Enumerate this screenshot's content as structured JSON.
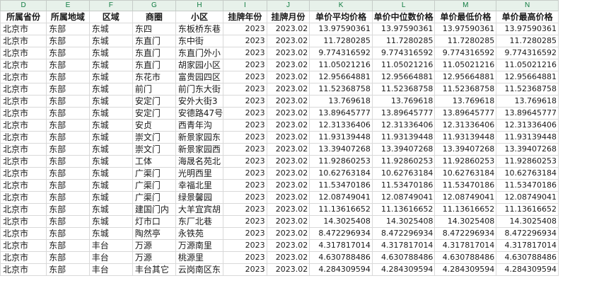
{
  "column_letters": [
    "D",
    "E",
    "F",
    "G",
    "H",
    "I",
    "J",
    "K",
    "L",
    "M",
    "N"
  ],
  "headers": [
    "所属省份",
    "所属地域",
    "区域",
    "商圈",
    "小区",
    "挂牌年份",
    "挂牌月份",
    "单价平均价格",
    "单价中位数价格",
    "单价最低价格",
    "单价最高价格"
  ],
  "rows": [
    [
      "北京市",
      "东部",
      "东城",
      "东四",
      "东板桥东巷",
      "2023",
      "2023.02",
      "13.97590361",
      "13.97590361",
      "13.97590361",
      "13.97590361"
    ],
    [
      "北京市",
      "东部",
      "东城",
      "东直门",
      "东中街",
      "2023",
      "2023.02",
      "11.7280285",
      "11.7280285",
      "11.7280285",
      "11.7280285"
    ],
    [
      "北京市",
      "东部",
      "东城",
      "东直门",
      "东直门外小",
      "2023",
      "2023.02",
      "9.774316592",
      "9.774316592",
      "9.774316592",
      "9.774316592"
    ],
    [
      "北京市",
      "东部",
      "东城",
      "东直门",
      "胡家园小区",
      "2023",
      "2023.02",
      "11.05021216",
      "11.05021216",
      "11.05021216",
      "11.05021216"
    ],
    [
      "北京市",
      "东部",
      "东城",
      "东花市",
      "富贵园四区",
      "2023",
      "2023.02",
      "12.95664881",
      "12.95664881",
      "12.95664881",
      "12.95664881"
    ],
    [
      "北京市",
      "东部",
      "东城",
      "前门",
      "前门东大街",
      "2023",
      "2023.02",
      "11.52368758",
      "11.52368758",
      "11.52368758",
      "11.52368758"
    ],
    [
      "北京市",
      "东部",
      "东城",
      "安定门",
      "安外大街3",
      "2023",
      "2023.02",
      "13.769618",
      "13.769618",
      "13.769618",
      "13.769618"
    ],
    [
      "北京市",
      "东部",
      "东城",
      "安定门",
      "安德路47号",
      "2023",
      "2023.02",
      "13.89645777",
      "13.89645777",
      "13.89645777",
      "13.89645777"
    ],
    [
      "北京市",
      "东部",
      "东城",
      "安贞",
      "西青年沟",
      "2023",
      "2023.02",
      "12.31336406",
      "12.31336406",
      "12.31336406",
      "12.31336406"
    ],
    [
      "北京市",
      "东部",
      "东城",
      "崇文门",
      "新景家园东",
      "2023",
      "2023.02",
      "11.93139448",
      "11.93139448",
      "11.93139448",
      "11.93139448"
    ],
    [
      "北京市",
      "东部",
      "东城",
      "崇文门",
      "新景家园西",
      "2023",
      "2023.02",
      "13.39407268",
      "13.39407268",
      "13.39407268",
      "13.39407268"
    ],
    [
      "北京市",
      "东部",
      "东城",
      "工体",
      "海晟名苑北",
      "2023",
      "2023.02",
      "11.92860253",
      "11.92860253",
      "11.92860253",
      "11.92860253"
    ],
    [
      "北京市",
      "东部",
      "东城",
      "广渠门",
      "光明西里",
      "2023",
      "2023.02",
      "10.62763184",
      "10.62763184",
      "10.62763184",
      "10.62763184"
    ],
    [
      "北京市",
      "东部",
      "东城",
      "广渠门",
      "幸福北里",
      "2023",
      "2023.02",
      "11.53470186",
      "11.53470186",
      "11.53470186",
      "11.53470186"
    ],
    [
      "北京市",
      "东部",
      "东城",
      "广渠门",
      "绿景馨园",
      "2023",
      "2023.02",
      "12.08749041",
      "12.08749041",
      "12.08749041",
      "12.08749041"
    ],
    [
      "北京市",
      "东部",
      "东城",
      "建国门内",
      "大羊宜宾胡",
      "2023",
      "2023.02",
      "11.13616652",
      "11.13616652",
      "11.13616652",
      "11.13616652"
    ],
    [
      "北京市",
      "东部",
      "东城",
      "灯市口",
      "东厂北巷",
      "2023",
      "2023.02",
      "14.3025408",
      "14.3025408",
      "14.3025408",
      "14.3025408"
    ],
    [
      "北京市",
      "东部",
      "东城",
      "陶然亭",
      "永铁苑",
      "2023",
      "2023.02",
      "8.472296934",
      "8.472296934",
      "8.472296934",
      "8.472296934"
    ],
    [
      "北京市",
      "东部",
      "丰台",
      "万源",
      "万源南里",
      "2023",
      "2023.02",
      "4.317817014",
      "4.317817014",
      "4.317817014",
      "4.317817014"
    ],
    [
      "北京市",
      "东部",
      "丰台",
      "万源",
      "桃源里",
      "2023",
      "2023.02",
      "4.630788486",
      "4.630788486",
      "4.630788486",
      "4.630788486"
    ],
    [
      "北京市",
      "东部",
      "丰台",
      "丰台其它",
      "云岗南区东",
      "2023",
      "2023.02",
      "4.284309594",
      "4.284309594",
      "4.284309594",
      "4.284309594"
    ]
  ]
}
